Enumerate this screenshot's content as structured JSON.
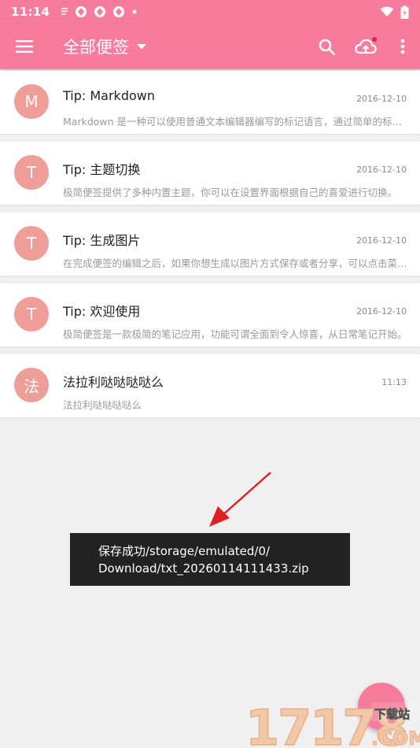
{
  "status_bar": {
    "time": "11:14",
    "icons": [
      "notes-icon",
      "app-icon",
      "app-icon",
      "app-icon",
      "dot-icon",
      "wifi-icon",
      "battery-icon"
    ]
  },
  "app_bar": {
    "title": "全部便签",
    "color": "#f77c9b",
    "actions": [
      "search-icon",
      "cloud-upload-icon",
      "more-vert-icon"
    ]
  },
  "notes": [
    {
      "avatar": "M",
      "title": "Tip: Markdown",
      "date": "2016-12-10",
      "preview": "Markdown 是一种可以使用普通文本编辑器编写的标记语言，通过简单的标记语法，它可以使普通文本内容具有一定的格式。"
    },
    {
      "avatar": "T",
      "title": "Tip: 主题切换",
      "date": "2016-12-10",
      "preview": "极简便签提供了多种内置主题，你可以在设置界面根据自己的喜爱进行切换。"
    },
    {
      "avatar": "T",
      "title": "Tip: 生成图片",
      "date": "2016-12-10",
      "preview": "在完成便签的编辑之后，如果你想生成以图片方式保存或者分享，可以点击菜单。"
    },
    {
      "avatar": "T",
      "title": "Tip: 欢迎使用",
      "date": "2016-12-10",
      "preview": "极简便签是一款极简的笔记应用，功能可谓全面到令人惊喜，从日常笔记开始。"
    },
    {
      "avatar": "法",
      "title": "法拉利哒哒哒哒么",
      "date": "11:13",
      "preview": "法拉利哒哒哒哒么"
    }
  ],
  "toast": {
    "line1": "保存成功/storage/emulated/0/",
    "line2": "Download/txt_20260114111433.zip"
  },
  "watermark": {
    "number": "17178",
    "label": "下载站",
    "suffix": ".COM"
  },
  "colors": {
    "accent": "#f77c9b",
    "avatar": "#ee9e96",
    "toast_bg": "#222222",
    "arrow": "#e02020"
  }
}
